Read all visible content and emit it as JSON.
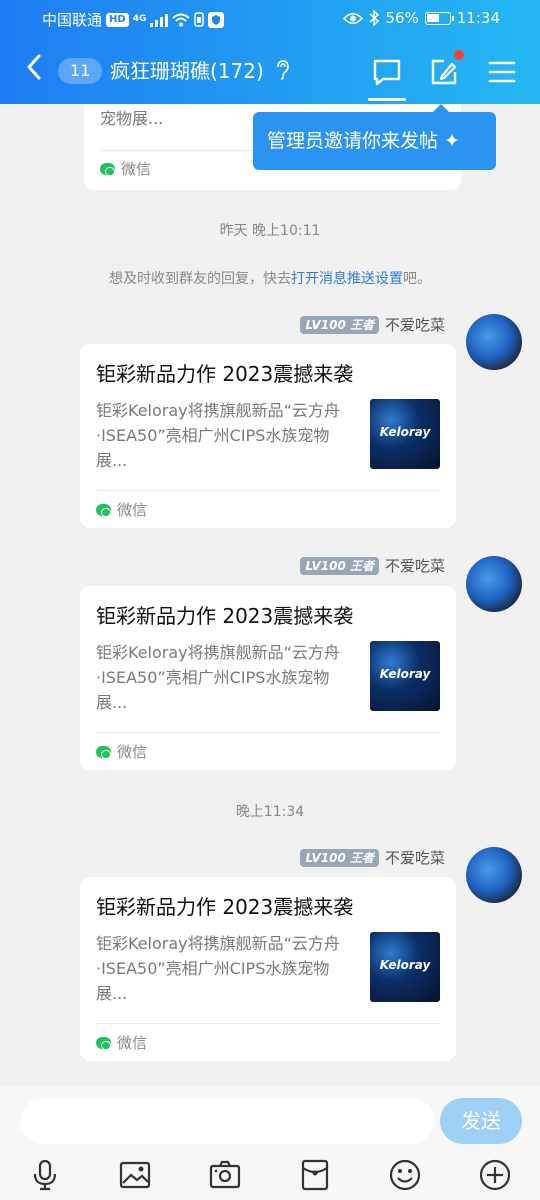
{
  "status": {
    "carrier": "中国联通",
    "hd": "HD",
    "network": "4G",
    "battery": "56%",
    "time": "11:34",
    "battery_level": 0.56
  },
  "header": {
    "unread": "11",
    "title": "疯狂珊瑚礁(172)"
  },
  "popup": {
    "text": "管理员邀请你来发帖 ✦"
  },
  "top_card": {
    "desc_fragment": "宠物展...",
    "source": "微信"
  },
  "time_1": "昨天 晚上10:11",
  "notice": {
    "before": "想及时收到群友的回复，快去",
    "link": "打开消息推送设置",
    "after": "吧。"
  },
  "messages": [
    {
      "level": "LV100 王者",
      "sender": "不爱吃菜",
      "title": "钜彩新品力作 2023震撼来袭",
      "desc": "钜彩Keloray将携旗舰新品“云方舟·ISEA50”亮相广州CIPS水族宠物展...",
      "thumb_text": "Keloray",
      "source": "微信"
    },
    {
      "level": "LV100 王者",
      "sender": "不爱吃菜",
      "title": "钜彩新品力作 2023震撼来袭",
      "desc": "钜彩Keloray将携旗舰新品“云方舟·ISEA50”亮相广州CIPS水族宠物展...",
      "thumb_text": "Keloray",
      "source": "微信"
    },
    {
      "level": "LV100 王者",
      "sender": "不爱吃菜",
      "title": "钜彩新品力作 2023震撼来袭",
      "desc": "钜彩Keloray将携旗舰新品“云方舟·ISEA50”亮相广州CIPS水族宠物展...",
      "thumb_text": "Keloray",
      "source": "微信"
    }
  ],
  "time_2": "晚上11:34",
  "input": {
    "send_label": "发送"
  },
  "toolbar_icons": [
    "mic-icon",
    "image-icon",
    "camera-icon",
    "red-packet-icon",
    "emoji-icon",
    "plus-icon"
  ],
  "colors": {
    "header_start": "#1e7df3",
    "header_end": "#25b8f2",
    "link": "#2f7de1",
    "send_button": "#9ed0f6"
  }
}
